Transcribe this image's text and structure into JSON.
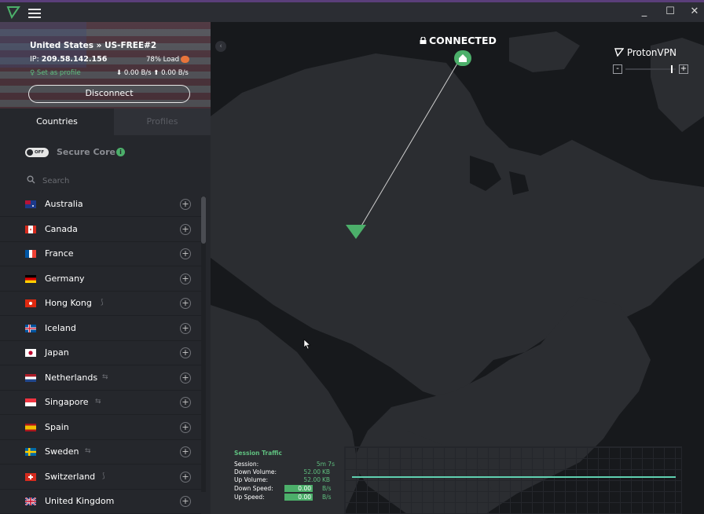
{
  "titlebar": {
    "minimize": "_",
    "maximize": "☐",
    "close": "✕"
  },
  "connection": {
    "server": "United States » US-FREE#2",
    "ip_label": "IP: ",
    "ip": "209.58.142.156",
    "load": "78% Load",
    "set_profile": "♀ Set as profile",
    "down_speed": "⬇ 0.00 B/s",
    "up_speed": "⬆ 0.00 B/s",
    "disconnect_label": "Disconnect"
  },
  "tabs": {
    "countries": "Countries",
    "profiles": "Profiles"
  },
  "secure_core": {
    "toggle_text": "OFF",
    "label": "Secure Core",
    "info": "i"
  },
  "search": {
    "placeholder": "Search"
  },
  "countries": [
    {
      "name": "Australia",
      "feature": ""
    },
    {
      "name": "Canada",
      "feature": ""
    },
    {
      "name": "France",
      "feature": ""
    },
    {
      "name": "Germany",
      "feature": ""
    },
    {
      "name": "Hong Kong",
      "feature": "⟆"
    },
    {
      "name": "Iceland",
      "feature": ""
    },
    {
      "name": "Japan",
      "feature": ""
    },
    {
      "name": "Netherlands",
      "feature": "⇆"
    },
    {
      "name": "Singapore",
      "feature": "⇆"
    },
    {
      "name": "Spain",
      "feature": ""
    },
    {
      "name": "Sweden",
      "feature": "⇆"
    },
    {
      "name": "Switzerland",
      "feature": "⟆"
    },
    {
      "name": "United Kingdom",
      "feature": ""
    }
  ],
  "map": {
    "status": "CONNECTED",
    "brand": "ProtonVPN",
    "zoom_minus": "-",
    "zoom_plus": "+",
    "collapse": "‹"
  },
  "session_traffic": {
    "title": "Session Traffic",
    "rows": [
      {
        "key": "Session:",
        "value": "5m 7s",
        "unit": ""
      },
      {
        "key": "Down Volume:",
        "value": "52.00",
        "unit": "KB"
      },
      {
        "key": "Up Volume:",
        "value": "52.00",
        "unit": "KB"
      },
      {
        "key": "Down Speed:",
        "value": "0.00",
        "unit": "B/s"
      },
      {
        "key": "Up Speed:",
        "value": "0.00",
        "unit": "B/s"
      }
    ]
  },
  "colors": {
    "accent_green": "#4caf6a",
    "background": "#1b1d21",
    "sidebar": "#25272c",
    "titlebar_border": "#5a3e7a"
  },
  "icons": {
    "logo": "protonvpn-logo-icon",
    "menu": "hamburger-icon",
    "lock": "lock-icon",
    "home": "home-icon",
    "search": "search-icon",
    "pin": "location-marker-icon",
    "cursor": "mouse-cursor-icon"
  }
}
